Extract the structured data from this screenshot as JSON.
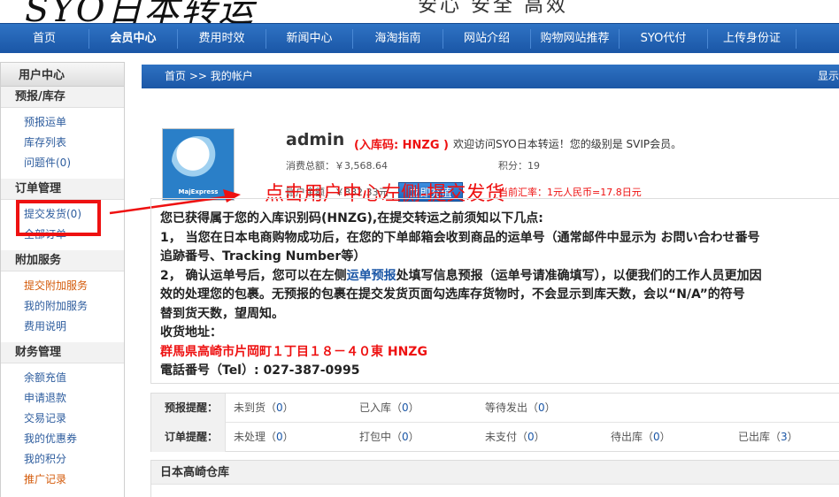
{
  "header": {
    "logo": "SYO日本转运",
    "slogan": "安心 安全 高效"
  },
  "nav": {
    "items": [
      {
        "label": "首页",
        "active": false
      },
      {
        "label": "会员中心",
        "active": true
      },
      {
        "label": "费用时效",
        "active": false
      },
      {
        "label": "新闻中心",
        "active": false
      },
      {
        "label": "海淘指南",
        "active": false
      },
      {
        "label": "网站介绍",
        "active": false
      },
      {
        "label": "购物网站推荐",
        "active": false
      },
      {
        "label": "SYO代付",
        "active": false
      },
      {
        "label": "上传身份证",
        "active": false
      }
    ]
  },
  "sidebar": {
    "title": "用户中心",
    "groups": [
      {
        "title": "预报/库存",
        "links": [
          "预报运单",
          "库存列表",
          "问题件(0)"
        ]
      },
      {
        "title": "订单管理",
        "links": [
          "提交发货(0)",
          "全部订单"
        ]
      },
      {
        "title": "附加服务",
        "links": [
          "提交附加服务",
          "我的附加服务",
          "费用说明"
        ]
      },
      {
        "title": "财务管理",
        "links": [
          "余额充值",
          "申请退款",
          "交易记录",
          "我的优惠券",
          "我的积分",
          "推广记录"
        ]
      }
    ]
  },
  "breadcrumb": {
    "path": "首页 >> 我的帐户",
    "right": "显示"
  },
  "account": {
    "avatar_caption": "MajExpress",
    "username": "admin",
    "code_text": "(入库码: HNZG )",
    "welcome": "欢迎访问SYO日本转运！您的级别是 SVIP会员。",
    "total_spend": "消费总额：￥3,568.64",
    "points": "积分：19",
    "balance": "账户余额：￥882.33元",
    "recharge_label": "立即充值",
    "rate": "当前汇率：1元人民币=17.8日元"
  },
  "annotation": "点击用户中心左侧-提交发货",
  "notice": {
    "l1": "您已获得属于您的入库识别码(HNZG),在提交转运之前须知以下几点:",
    "l2": "1， 当您在日本电商购物成功后，在您的下单邮箱会收到商品的运单号（通常邮件中显示为 お問い合わせ番号",
    "l3": "追跡番号、Tracking Number等）",
    "l4_a": "2， 确认运单号后，您可以在左侧",
    "l4_link": "运单预报",
    "l4_b": "处填写信息预报（运单号请准确填写），以便我们的工作人员更加因",
    "l5": "效的处理您的包裹。无预报的包裹在提交发货页面勾选库存货物时，不会显示到库天数，会以“N/A”的符号",
    "l6": "替到货天数，望周知。",
    "l7": "收货地址：",
    "l8": "群馬県高崎市片岡町１丁目１８－４０東 HNZG",
    "l9": "電話番号（Tel）: 027-387-0995"
  },
  "stats": {
    "forecast": {
      "label": "预报提醒：",
      "cells": [
        {
          "name": "未到货",
          "value": "0"
        },
        {
          "name": "已入库",
          "value": "0"
        },
        {
          "name": "等待发出",
          "value": "0"
        }
      ]
    },
    "orders": {
      "label": "订单提醒：",
      "cells": [
        {
          "name": "未处理",
          "value": "0"
        },
        {
          "name": "打包中",
          "value": "0"
        },
        {
          "name": "未支付",
          "value": "0"
        },
        {
          "name": "待出库",
          "value": "0"
        },
        {
          "name": "已出库",
          "value": "3"
        }
      ]
    }
  },
  "warehouse": {
    "title": "日本高崎仓库"
  }
}
